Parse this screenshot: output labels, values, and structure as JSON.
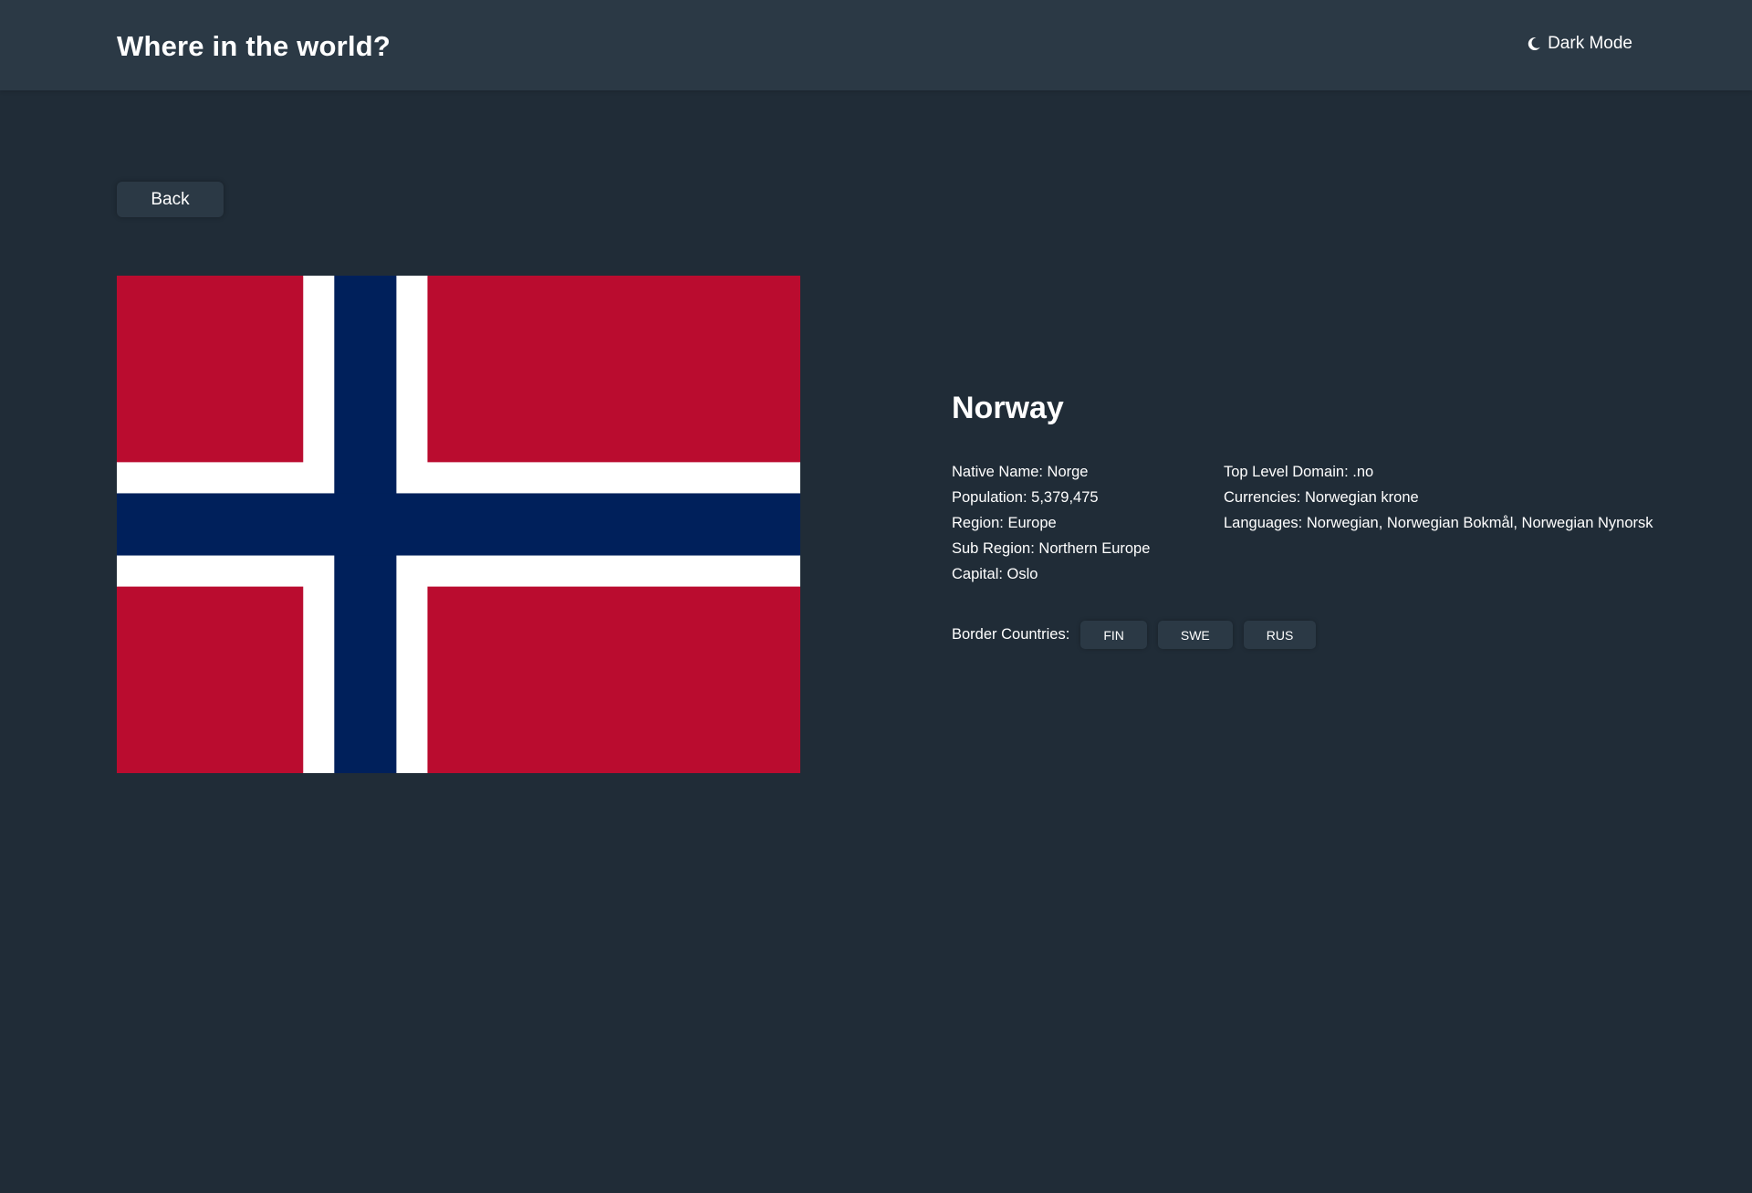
{
  "header": {
    "title": "Where in the world?",
    "theme_toggle_label": "Dark Mode",
    "theme_icon": "moon-icon"
  },
  "back_button_label": "Back",
  "flag": {
    "icon": "norway-flag",
    "colors": {
      "red": "#ba0c2f",
      "white": "#ffffff",
      "blue": "#00205b"
    }
  },
  "country": {
    "name": "Norway",
    "left_column": [
      {
        "label": "Native Name:",
        "value": "Norge"
      },
      {
        "label": "Population:",
        "value": "5,379,475"
      },
      {
        "label": "Region:",
        "value": "Europe"
      },
      {
        "label": "Sub Region:",
        "value": "Northern Europe"
      },
      {
        "label": "Capital:",
        "value": "Oslo"
      }
    ],
    "right_column": [
      {
        "label": "Top Level Domain:",
        "value": ".no"
      },
      {
        "label": "Currencies:",
        "value": "Norwegian krone"
      },
      {
        "label": "Languages:",
        "value": "Norwegian, Norwegian Bokmål, Norwegian Nynorsk"
      }
    ],
    "border_countries_label": "Border Countries:",
    "border_countries": [
      "FIN",
      "SWE",
      "RUS"
    ]
  },
  "colors": {
    "background": "#202c37",
    "element": "#2b3945",
    "text": "#ffffff"
  }
}
